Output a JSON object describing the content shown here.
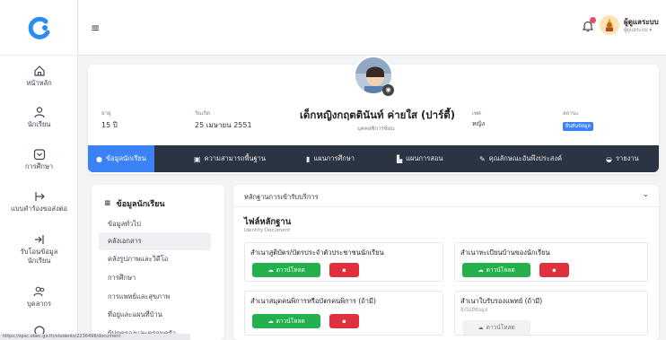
{
  "sidebar": {
    "items": [
      {
        "label": "หน้าหลัก",
        "icon": "home-icon"
      },
      {
        "label": "นักเรียน",
        "icon": "user-icon"
      },
      {
        "label": "การศึกษา",
        "icon": "education-icon"
      },
      {
        "label": "แบบคำร้องขอส่งต่อ",
        "icon": "forward-icon"
      },
      {
        "label": "รับโอนข้อมูล นักเรียน",
        "icon": "transfer-icon"
      },
      {
        "label": "บุคลากร",
        "icon": "staff-icon"
      }
    ]
  },
  "topbar": {
    "user_name": "ผู้ดูแลระบบ",
    "user_role": "ผู้ดูแลระบบ ▾"
  },
  "profile": {
    "age_label": "อายุ",
    "age_value": "15 ปี",
    "birth_label": "วันเกิด",
    "birth_value": "25 เมษายน 2551",
    "name": "เด็กหญิงกฤตตินันท์ ค่ายใส (ปาร์ตี้)",
    "sub": "บุคคลพิการซ้อน",
    "gender_label": "เพศ",
    "gender_value": "หญิง",
    "status_label": "สถานะ",
    "status_value": "ยืนยันข้อมูล"
  },
  "tabs": [
    {
      "label": "ข้อมูลนักเรียน",
      "icon": "user-icon"
    },
    {
      "label": "ความสามารถพื้นฐาน",
      "icon": "check-square-icon"
    },
    {
      "label": "แผนการศึกษา",
      "icon": "book-icon"
    },
    {
      "label": "แผนการสอน",
      "icon": "file-icon"
    },
    {
      "label": "คุณลักษณะอันพึงประสงค์",
      "icon": "edit-icon"
    },
    {
      "label": "รายงาน",
      "icon": "report-icon"
    }
  ],
  "menu": {
    "title": "ข้อมูลนักเรียน",
    "items": [
      "ข้อมูลทั่วไป",
      "คลังเอกสาร",
      "คลังรูปภาพและวิดีโอ",
      "การศึกษา",
      "การแพทย์และสุขภาพ",
      "ที่อยู่และแผนที่บ้าน",
      "ผู้ปกครองและครอบครัว"
    ]
  },
  "documents": {
    "header": "หลักฐานการเข้ารับบริการ",
    "section_title": "ไฟล์หลักฐาน",
    "section_sub": "Identity Document",
    "boxes": [
      {
        "title": "สำเนาสูติบัตร/บัตรประจำตัวประชาชนนักเรียน",
        "sub": ""
      },
      {
        "title": "สำเนาทะเบียนบ้านของนักเรียน",
        "sub": ""
      },
      {
        "title": "สำเนาสมุดคนพิการหรือบัตรคนพิการ (ถ้ามี)",
        "sub": ""
      },
      {
        "title": "สำเนาใบรับรองแพทย์ (ถ้ามี)",
        "sub": "ยังไม่มีข้อมูล"
      }
    ],
    "download_label": "ดาวน์โหลด",
    "delete_label": "ลบ"
  },
  "status_url": "https://spsc.obec.go.th/students/2236498/document"
}
